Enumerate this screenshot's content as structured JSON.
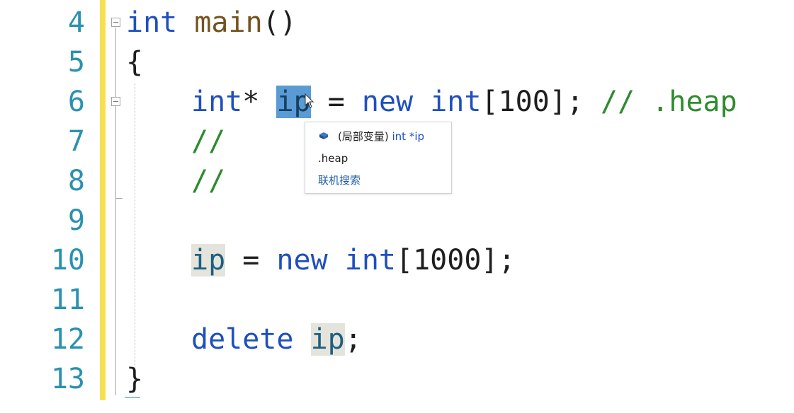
{
  "editor": {
    "line_numbers": [
      "4",
      "5",
      "6",
      "7",
      "8",
      "9",
      "10",
      "11",
      "12",
      "13"
    ],
    "lines": {
      "l4": {
        "kw1": "int",
        "fn": "main",
        "rest": "()"
      },
      "l5": {
        "text": "{"
      },
      "l6": {
        "kw1": "int",
        "op": "*",
        "sel": "ip",
        "eq": " = ",
        "kw2": "new",
        "kw3": "int",
        "rest": "[100]; ",
        "comment": "// .heap"
      },
      "l7": {
        "comment": "//"
      },
      "l8": {
        "comment": "//"
      },
      "l10": {
        "ref": "ip",
        "eq": " = ",
        "kw2": "new",
        "kw3": "int",
        "rest": "[1000];"
      },
      "l12": {
        "kw": "delete",
        "ref": "ip",
        "rest": ";"
      },
      "l13": {
        "text": "}"
      }
    }
  },
  "tooltip": {
    "scope": "(局部变量)",
    "type": "int *ip",
    "doc": ".heap",
    "link": "联机搜索"
  },
  "colors": {
    "keyword": "#1f4fbf",
    "comment": "#2e8b2e",
    "line_number": "#2b91af",
    "change_bar": "#f5e04f",
    "selection": "#5a9bd5"
  }
}
